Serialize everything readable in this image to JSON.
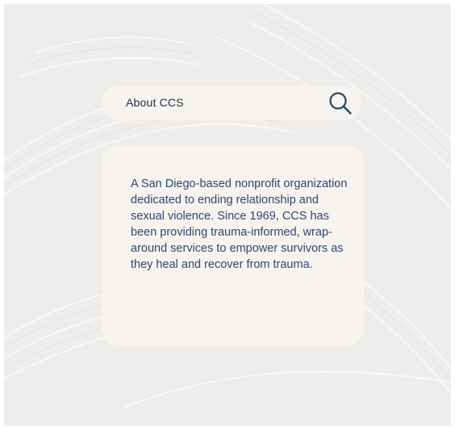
{
  "search": {
    "label": "About CCS",
    "icon": "search-icon"
  },
  "about": {
    "text": "A San Diego-based nonprofit organization dedicated to ending relationship and sexual violence. Since 1969, CCS has been providing trauma-informed, wrap-around services to empower survivors as they heal and recover from trauma."
  },
  "colors": {
    "background": "#eeedeb",
    "panel": "#f7f4ef",
    "text_dark": "#1f2f4a",
    "text_blue": "#2e4672",
    "icon": "#2a4366"
  }
}
